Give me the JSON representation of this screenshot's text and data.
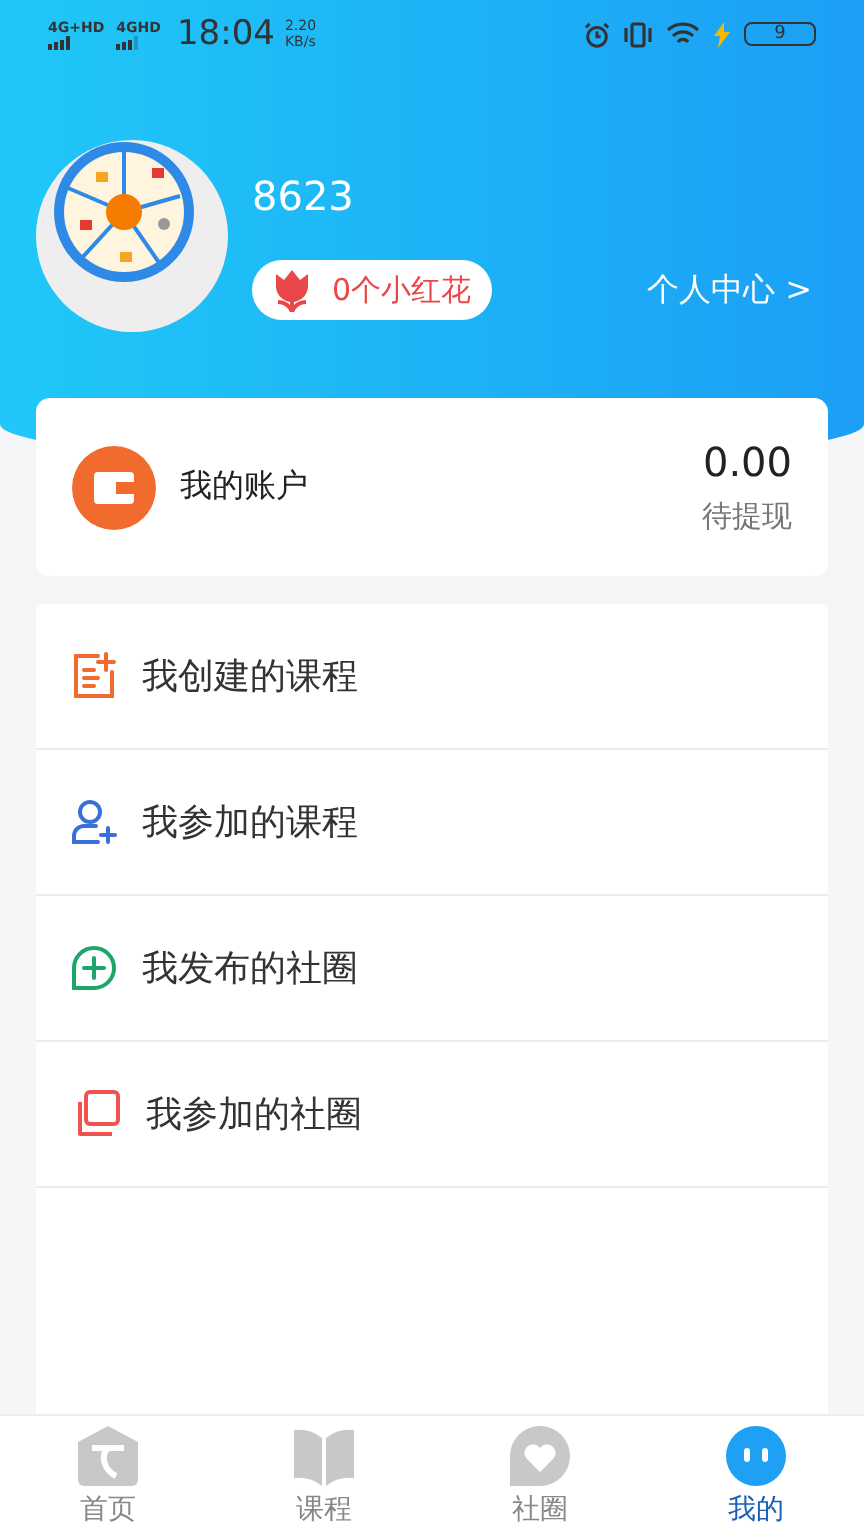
{
  "status_bar": {
    "network_1": "4G+HD",
    "network_2": "4GHD",
    "time": "18:04",
    "speed_value": "2.20",
    "speed_unit": "KB/s",
    "battery": "9"
  },
  "profile": {
    "name": "8623",
    "flowers": "0个小红花",
    "center_link": "个人中心 >"
  },
  "account": {
    "label": "我的账户",
    "amount": "0.00",
    "amount_label": "待提现"
  },
  "menu": [
    {
      "label": "我创建的课程",
      "kind": "create",
      "color": "#f26b2e"
    },
    {
      "label": "我参加的课程",
      "kind": "join",
      "color": "#3a6fd8"
    },
    {
      "label": "我发布的社圈",
      "kind": "publish",
      "color": "#1ea66a"
    },
    {
      "label": "我参加的社圈",
      "kind": "copy",
      "color": "#ef5350"
    }
  ],
  "tabs": [
    {
      "label": "首页",
      "kind": "home",
      "selected": false
    },
    {
      "label": "课程",
      "kind": "book",
      "selected": false
    },
    {
      "label": "社圈",
      "kind": "heart",
      "selected": false
    },
    {
      "label": "我的",
      "kind": "me",
      "selected": true
    }
  ]
}
